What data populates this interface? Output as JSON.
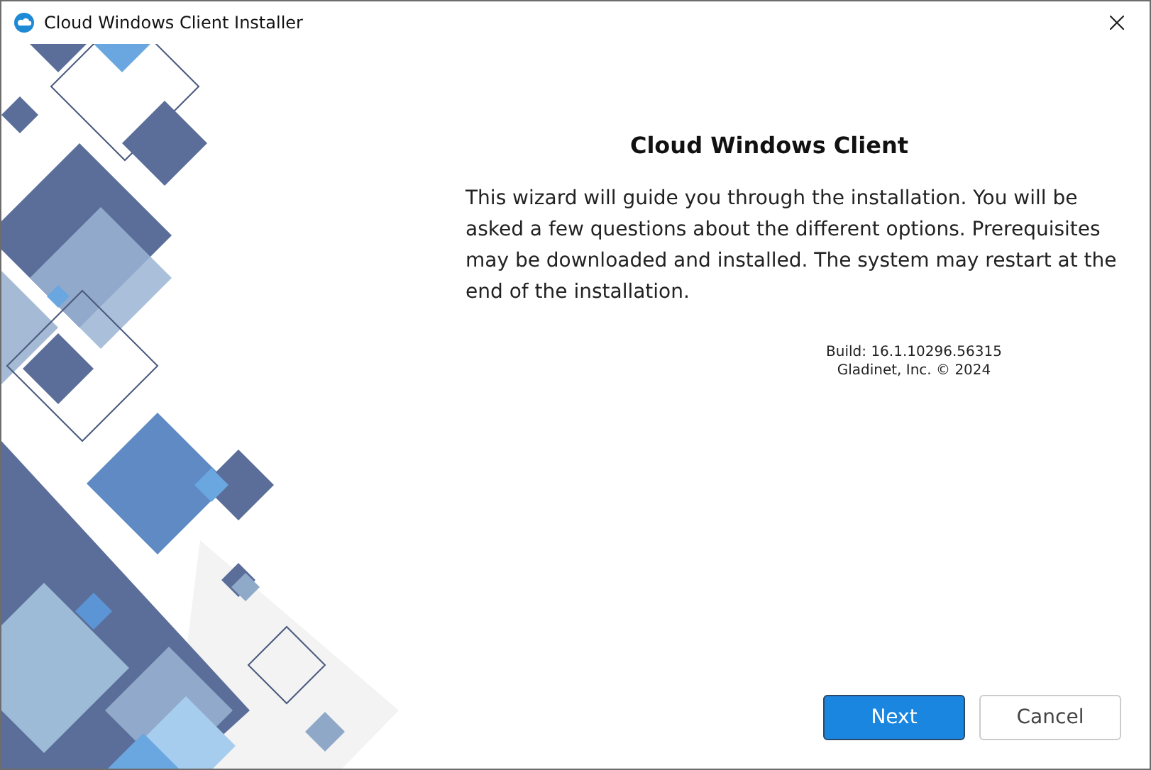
{
  "window": {
    "title": "Cloud Windows Client Installer"
  },
  "heading": "Cloud Windows Client",
  "description": "This wizard will guide you through the installation. You will be asked a few questions about the different options. Prerequisites may be downloaded and installed. The system may restart at the end of the installation.",
  "build": "Build: 16.1.10296.56315",
  "copyright": "Gladinet, Inc. © 2024",
  "buttons": [
    {
      "label": "Next",
      "kind": "primary"
    },
    {
      "label": "Cancel",
      "kind": "secondary"
    }
  ]
}
